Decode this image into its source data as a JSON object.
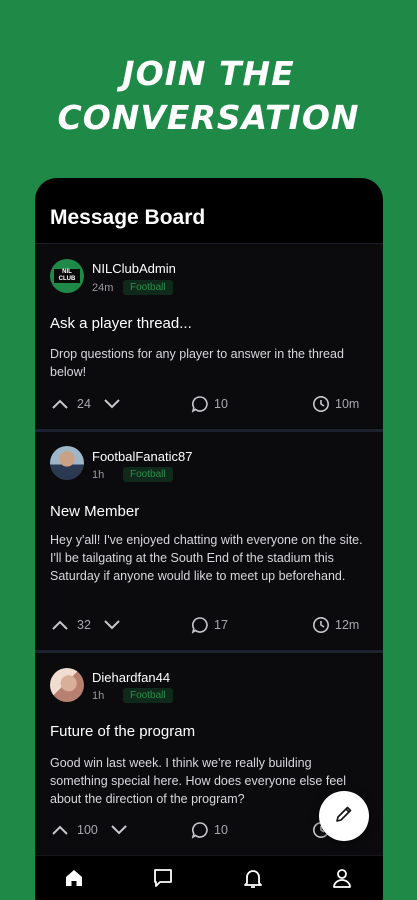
{
  "promo": {
    "headline_line1": "JOIN THE",
    "headline_line2": "CONVERSATION"
  },
  "board": {
    "title": "Message Board"
  },
  "posts": [
    {
      "username": "NILClubAdmin",
      "time": "24m",
      "tag": "Football",
      "avatar_text": "NIL CLUB",
      "title": "Ask a player thread...",
      "body": "Drop questions for any player to answer in the thread below!",
      "votes": "24",
      "comments": "10",
      "age": "10m"
    },
    {
      "username": "FootbalFanatic87",
      "time": "1h",
      "tag": "Football",
      "title": "New Member",
      "body": "Hey y'all! I've enjoyed chatting with everyone on the site. I'll be tailgating at the South End of the stadium this Saturday if anyone would like to meet up beforehand.",
      "votes": "32",
      "comments": "17",
      "age": "12m"
    },
    {
      "username": "Diehardfan44",
      "time": "1h",
      "tag": "Football",
      "title": "Future of the program",
      "body": "Good win last week. I think we're really building something special here. How does everyone else feel about the direction of the program?",
      "votes": "100",
      "comments": "10",
      "age": ""
    }
  ],
  "nav": {
    "items": [
      "home-icon",
      "chat-icon",
      "bell-icon",
      "profile-icon"
    ],
    "active": "home-icon"
  },
  "colors": {
    "brand_green": "#1f8a47",
    "tag_text": "#2c8c4e",
    "tag_bg": "#0f2a1a",
    "card_bg": "#0b0b0d"
  }
}
